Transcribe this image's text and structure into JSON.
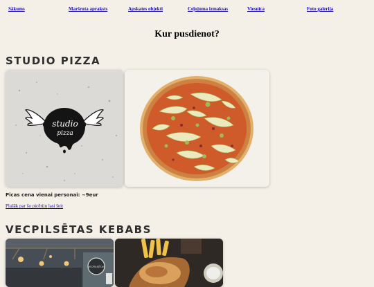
{
  "nav": {
    "items": [
      "Sākums",
      "Maršruta apraksts",
      "Apskates objekti",
      "Ceļojuma izmaksas",
      "Viesnīca",
      "Foto galerija"
    ]
  },
  "page": {
    "title": "Kur pusdienot?"
  },
  "sections": [
    {
      "title": "STUDIO PIZZA",
      "logo_text_1": "studio",
      "logo_text_2": "pizza",
      "price_text": "Picas cena vienai personai: ~9eur",
      "link_text": "Plašāk par šo picēriju lasi šeit"
    },
    {
      "title": "VECPILSĒTAS KEBABS",
      "sign_text": "VECPILSĒTAS"
    }
  ],
  "colors": {
    "background": "#f4f0e7",
    "link": "#1a0dab",
    "heading": "#2f2f2f"
  }
}
